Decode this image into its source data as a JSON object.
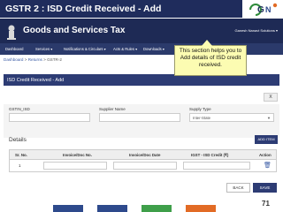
{
  "slide": {
    "title": "GSTR 2 : ISD Credit Received - Add",
    "page_number": "71"
  },
  "gov_header": {
    "title": "Goods and Services Tax"
  },
  "nav": {
    "items": [
      "Dashboard",
      "Services ▾",
      "Notifications & Circulars ▾",
      "Acts & Rules ▾",
      "Downloads ▾"
    ],
    "user": "Ganesh Nanavt Solutions ▾"
  },
  "breadcrumb": {
    "items": [
      "Dashboard",
      "Returns",
      "GSTR-2"
    ],
    "separator": ">"
  },
  "callout": {
    "text": "This section helps you to Add details of ISD credit received."
  },
  "panel": {
    "title": "ISD Credit Received - Add"
  },
  "close_label": "X",
  "form": {
    "gstin_label": "GSTIN_ISD",
    "supplier_label": "Supplier Name",
    "supply_type_label": "Supply Type",
    "supply_type_value": "Inter-State"
  },
  "details": {
    "label": "Details",
    "add_item_label": "ADD ITEM"
  },
  "table": {
    "headers": [
      "Sr. No.",
      "Invoice/Doc No.",
      "Invoice/Doc Date",
      "IGST - ISD Credit (₹)",
      "Action"
    ],
    "rows": [
      {
        "sr": "1"
      }
    ]
  },
  "buttons": {
    "back": "BACK",
    "save": "SAVE"
  },
  "colors": {
    "header_navy": "#1e2a55",
    "panel_blue": "#2d3c74",
    "callout_yellow": "#fcfcb2",
    "footer_blue": "#2e4a8c",
    "footer_green": "#3f9f4a",
    "footer_orange": "#e26b25"
  },
  "icons": {
    "emblem": "emblem-icon",
    "delete": "trash-icon",
    "logo": "gstn-logo"
  }
}
